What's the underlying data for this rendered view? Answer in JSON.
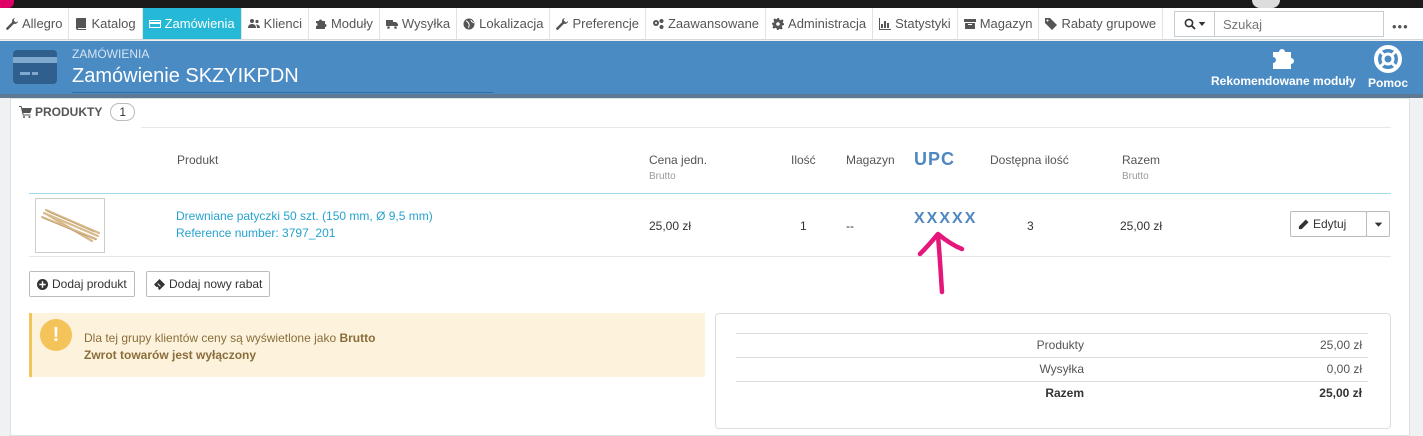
{
  "nav": {
    "items": [
      {
        "label": "Allegro",
        "icon": "wrench-icon"
      },
      {
        "label": "Katalog",
        "icon": "book-icon"
      },
      {
        "label": "Zamówienia",
        "icon": "credit-card-icon",
        "active": true
      },
      {
        "label": "Klienci",
        "icon": "users-icon"
      },
      {
        "label": "Moduły",
        "icon": "puzzle-icon"
      },
      {
        "label": "Wysyłka",
        "icon": "truck-icon"
      },
      {
        "label": "Lokalizacja",
        "icon": "globe-icon"
      },
      {
        "label": "Preferencje",
        "icon": "wrench-icon"
      },
      {
        "label": "Zaawansowane",
        "icon": "cogs-icon"
      },
      {
        "label": "Administracja",
        "icon": "cog-icon"
      },
      {
        "label": "Statystyki",
        "icon": "bar-chart-icon"
      },
      {
        "label": "Magazyn",
        "icon": "archive-icon"
      },
      {
        "label": "Rabaty grupowe",
        "icon": "tag-icon"
      }
    ],
    "search_placeholder": "Szukaj",
    "more": "•••"
  },
  "header": {
    "breadcrumb": "Zamówienia",
    "title": "Zamówienie SKZYIKPDN",
    "modules_button": "Rekomendowane moduły",
    "help_button": "Pomoc"
  },
  "products": {
    "heading": "Produkty",
    "count": "1",
    "columns": {
      "product": "Produkt",
      "unit_price": "Cena jedn.",
      "unit_price_sub": "Brutto",
      "qty": "Ilość",
      "warehouse": "Magazyn",
      "upc": "UPC",
      "available": "Dostępna ilość",
      "total": "Razem",
      "total_sub": "Brutto"
    },
    "rows": [
      {
        "name": "Drewniane patyczki 50 szt. (150 mm, Ø 9,5 mm)",
        "reference": "Reference number: 3797_201",
        "unit_price": "25,00 zł",
        "qty": "1",
        "warehouse": "--",
        "upc": "XXXXX",
        "available": "3",
        "total": "25,00 zł",
        "edit": "Edytuj"
      }
    ],
    "add_product": "Dodaj produkt",
    "add_discount": "Dodaj nowy rabat"
  },
  "alert": {
    "text": "Dla tej grupy klientów ceny są wyświetlone jako",
    "emphasis": "Brutto",
    "returns": "Zwrot towarów jest wyłączony"
  },
  "totals": [
    {
      "label": "Produkty",
      "value": "25,00 zł"
    },
    {
      "label": "Wysyłka",
      "value": "0,00 zł"
    },
    {
      "label": "Razem",
      "value": "25,00 zł"
    }
  ],
  "colors": {
    "nav_active": "#25b9d7",
    "header": "#4a8bc4",
    "link": "#25a2cf",
    "annotation_arrow": "#e6177a",
    "upc_annotation": "#4f87c0"
  }
}
